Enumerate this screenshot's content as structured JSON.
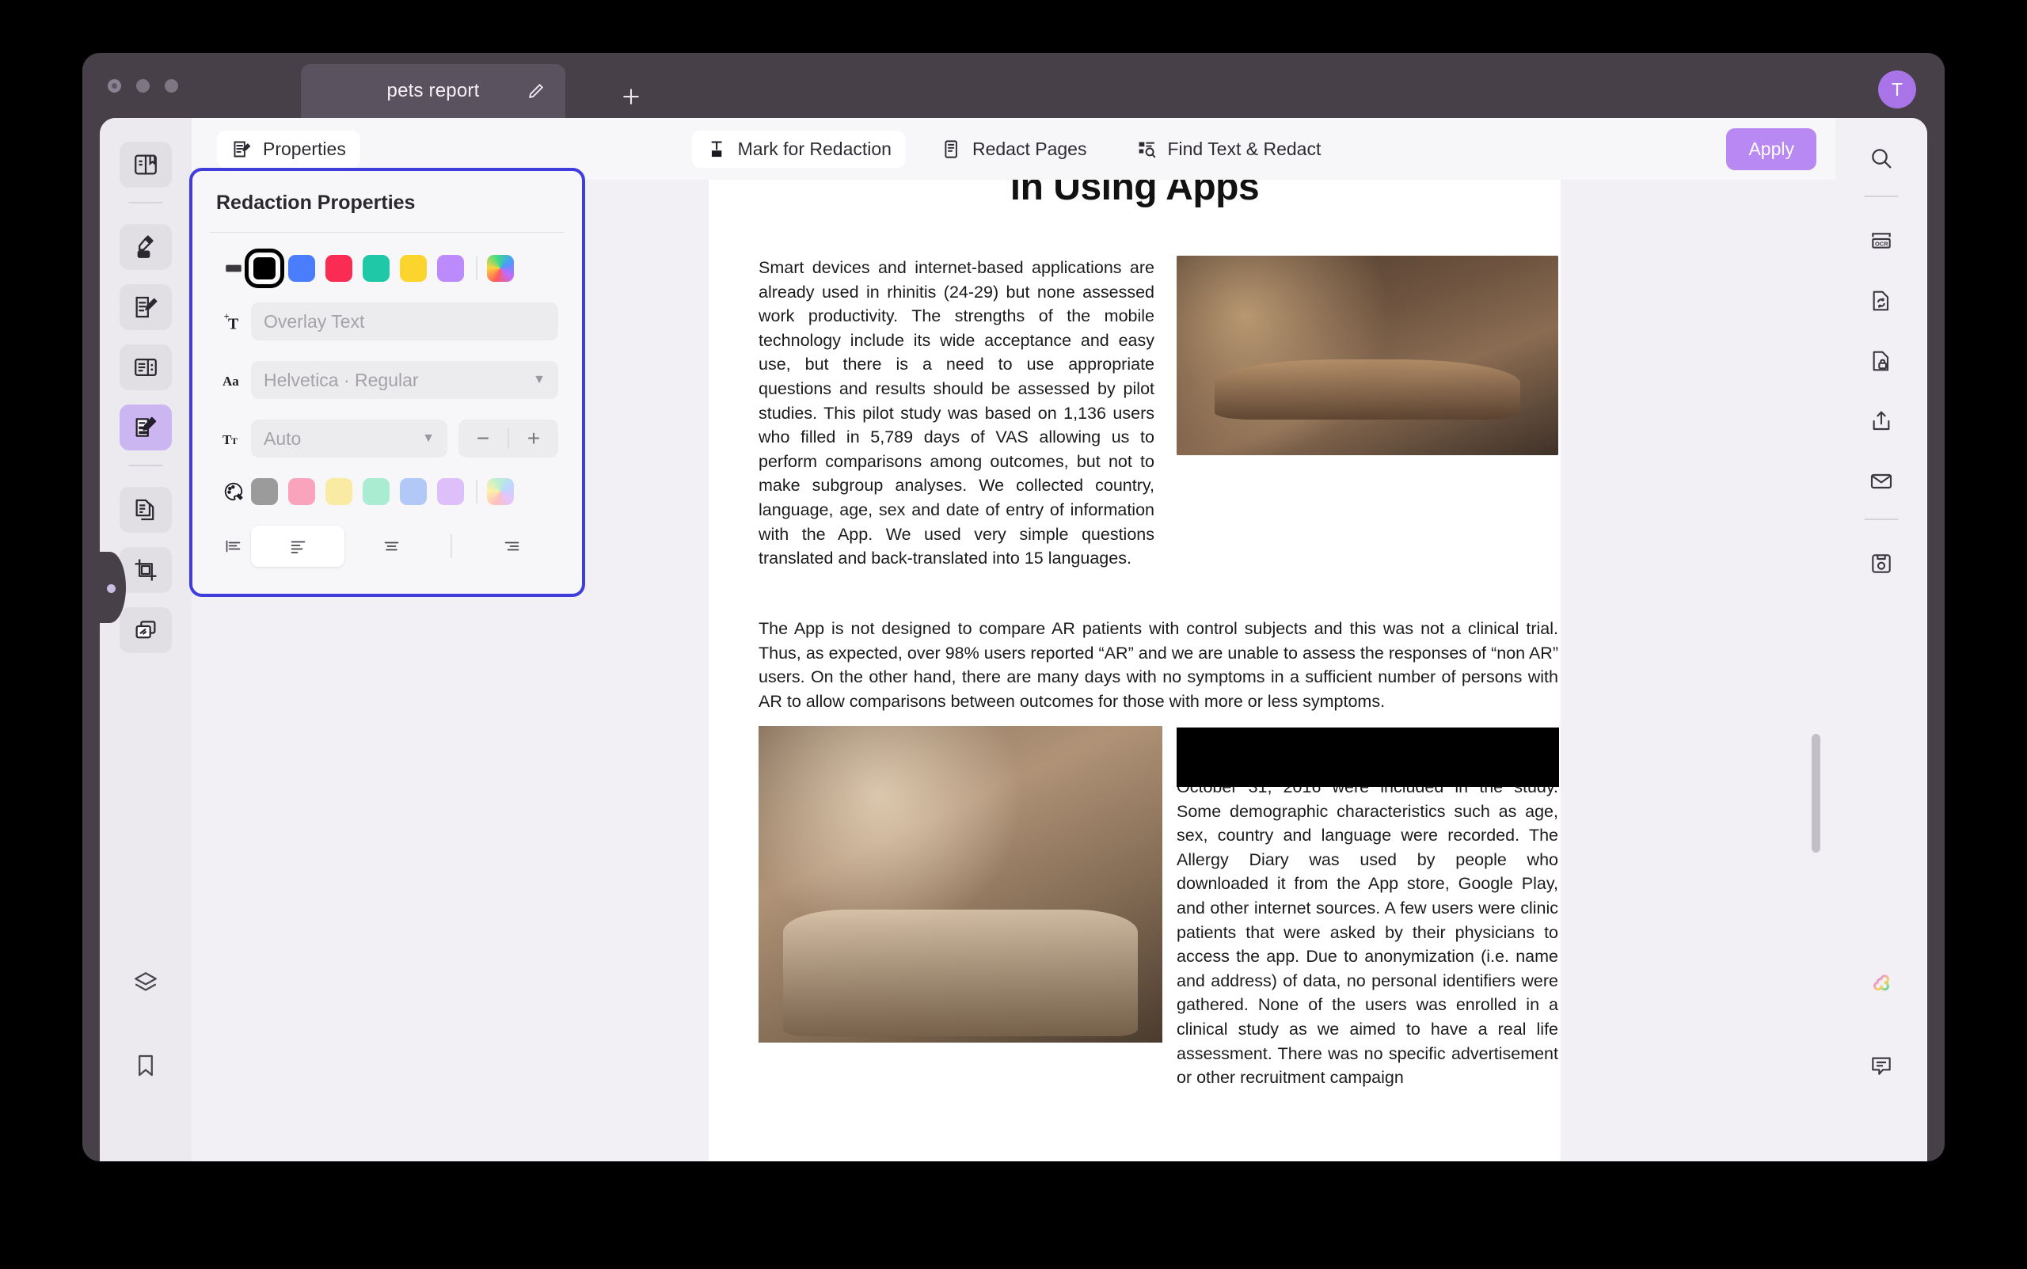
{
  "window": {
    "tab_title": "pets report",
    "tab_edit_icon": "pencil-icon",
    "new_tab_icon": "plus-icon",
    "avatar_initial": "T",
    "accent_color": "#b889f2",
    "titlebar_color": "#474049"
  },
  "toolbar": {
    "properties_label": "Properties",
    "mark_for_redaction_label": "Mark for Redaction",
    "redact_pages_label": "Redact Pages",
    "find_text_redact_label": "Find Text & Redact",
    "apply_label": "Apply"
  },
  "left_rail": {
    "items": [
      {
        "name": "reader-view",
        "icon": "book-open-icon",
        "active": false
      },
      {
        "name": "highlighter",
        "icon": "marker-icon",
        "active": false
      },
      {
        "name": "edit-document",
        "icon": "document-pencil-icon",
        "active": false
      },
      {
        "name": "forms",
        "icon": "document-columns-icon",
        "active": false
      },
      {
        "name": "redaction",
        "icon": "redaction-marker-icon",
        "active": true
      },
      {
        "name": "organize-pages",
        "icon": "pages-copy-icon",
        "active": false
      },
      {
        "name": "crop-pages",
        "icon": "crop-icon",
        "active": false
      },
      {
        "name": "combine-files",
        "icon": "stack-files-icon",
        "active": false
      },
      {
        "name": "layers",
        "icon": "layers-icon",
        "active": false
      },
      {
        "name": "bookmarks",
        "icon": "bookmark-icon",
        "active": false
      }
    ]
  },
  "right_rail": {
    "items": [
      {
        "name": "search",
        "icon": "magnifier-icon"
      },
      {
        "name": "ocr",
        "icon": "ocr-icon"
      },
      {
        "name": "convert",
        "icon": "document-refresh-icon"
      },
      {
        "name": "protect",
        "icon": "document-lock-icon"
      },
      {
        "name": "share",
        "icon": "share-upload-icon"
      },
      {
        "name": "email",
        "icon": "envelope-icon"
      },
      {
        "name": "save",
        "icon": "floppy-save-icon"
      },
      {
        "name": "ai-assistant",
        "icon": "ai-clover-icon"
      },
      {
        "name": "comments",
        "icon": "comment-bubble-icon"
      }
    ]
  },
  "panel": {
    "title": "Redaction Properties",
    "fill_color_row": {
      "icon": "fill-swatch-icon",
      "current": "#3a383c",
      "swatches": [
        "#000000",
        "#4a7dfb",
        "#fb2c53",
        "#1fc9a8",
        "#fbd52e",
        "#bc8bfb"
      ],
      "selected_index": 0,
      "custom_icon": "rainbow-picker-icon"
    },
    "overlay_text": {
      "icon": "add-text-icon",
      "placeholder": "Overlay Text",
      "value": ""
    },
    "font": {
      "icon": "font-family-icon",
      "value": "Helvetica · Regular",
      "caret_icon": "chevron-down-icon"
    },
    "font_size": {
      "icon": "font-size-icon",
      "value": "Auto",
      "caret_icon": "chevron-down-icon",
      "decrease_icon": "minus-icon",
      "increase_icon": "plus-icon"
    },
    "text_color_row": {
      "icon": "palette-icon",
      "current": "#9b9b9b",
      "swatches": [
        "#f9a4bc",
        "#f9eba4",
        "#a9ecd1",
        "#b2c9f7",
        "#ddc0f9"
      ],
      "custom_icon": "rainbow-picker-icon"
    },
    "alignment": {
      "icon": "text-align-label-icon",
      "options": [
        {
          "name": "align-left",
          "icon": "align-left-icon",
          "selected": true
        },
        {
          "name": "align-center",
          "icon": "align-center-icon",
          "selected": false
        },
        {
          "name": "align-right",
          "icon": "align-right-icon",
          "selected": false
        }
      ]
    }
  },
  "document": {
    "heading": "in Using Apps",
    "column_left": "Smart devices and internet-based applications are already used in rhinitis (24-29) but none assessed work productivity. The strengths of the mobile technology include its wide acceptance and easy use, but there is a need to use appropriate questions and results should be assessed by pilot studies. This pilot study was based on 1,136 users who filled in 5,789 days of VAS allowing us to perform comparisons among outcomes, but not to make subgroup analyses. We collected country, language, age, sex and date of entry of information with the App. We used very simple questions translated and back-translated into 15 languages.",
    "paragraph_wide": "The App is not designed to compare AR patients with control subjects and this was not a clinical trial. Thus, as expected, over 98% users reported “AR” and we are unable to assess the responses of “non AR” users. On the other hand, there are many days with no symptoms in a sufficient number of persons with AR to allow comparisons between outcomes for those with more or less symptoms.",
    "redacted_block_label": "redacted-black-bar",
    "column_right": "October 31, 2016 were included in the study. Some demographic characteristics such as age, sex, country and language were recorded. The Allergy Diary was used by people who downloaded it from the App store, Google Play, and other internet sources. A few users were clinic patients that were asked by their physicians to access the app. Due to anonymization (i.e. name and address) of data, no personal identifiers were gathered. None of the users was enrolled in a clinical study as we aimed to have a real life assessment. There was no specific advertisement or other recruitment campaign",
    "image_1_alt": "conference-room-photo",
    "image_2_alt": "coworking-table-photo"
  }
}
